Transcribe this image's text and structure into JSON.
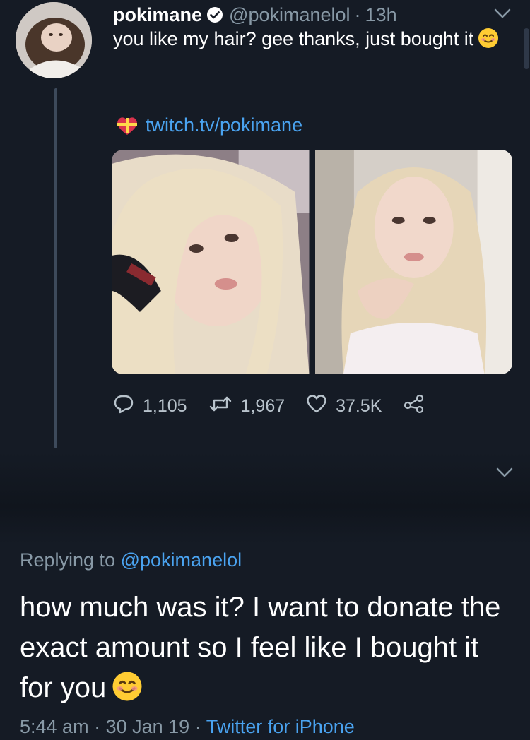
{
  "tweet": {
    "display_name": "pokimane",
    "handle": "@pokimanelol",
    "separator": "·",
    "time": "13h",
    "text": "you like my hair? gee thanks, just bought it",
    "link": "twitch.tv/pokimane",
    "stats": {
      "replies": "1,105",
      "retweets": "1,967",
      "likes": "37.5K"
    }
  },
  "reply": {
    "replying_label": "Replying to",
    "replying_to": "@pokimanelol",
    "text": "how much was it? I want to donate the exact amount so I feel like I bought it for you",
    "time": "5:44 am",
    "separator1": "·",
    "date": "30 Jan 19",
    "separator2": "·",
    "source": "Twitter for iPhone"
  },
  "icons": {
    "verified": "verified-check-icon",
    "reply": "reply-icon",
    "retweet": "retweet-icon",
    "like": "heart-icon",
    "share": "share-icon",
    "caret": "chevron-down-icon",
    "gift": "gift-heart-emoji",
    "smile": "smiling-face-emoji"
  },
  "colors": {
    "background": "#151b25",
    "link": "#4aa3f0",
    "muted": "#8899a6",
    "text": "#ffffff"
  }
}
